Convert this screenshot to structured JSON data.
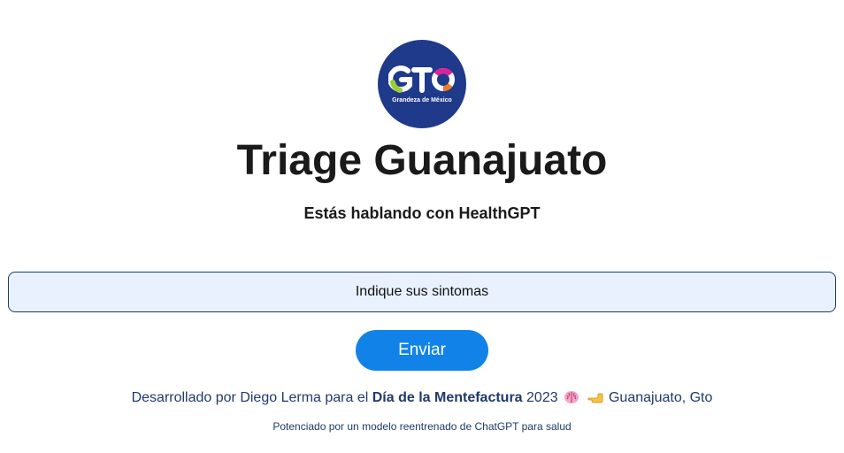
{
  "colors": {
    "logo_background": "#1f3a8a",
    "input_background": "#e8f1fd",
    "input_border": "#1f3a6b",
    "button_background": "#1183e8",
    "button_text": "#ffffff",
    "footer_text": "#1f3a6b"
  },
  "logo": {
    "text": "GTO",
    "tagline": "Grandeza de México",
    "icon": "gto-logo"
  },
  "header": {
    "title": "Triage Guanajuato",
    "subtitle": "Estás hablando con HealthGPT"
  },
  "chat": {
    "input_placeholder": "Indique sus sintomas",
    "input_value": "",
    "send_label": "Enviar"
  },
  "footer": {
    "credits_prefix": "Desarrollado por Diego Lerma para el",
    "credits_event": "Día de la Mentefactura",
    "credits_year": "2023",
    "emoji_1": "brain-emoji",
    "emoji_2": "pointing-hand-emoji",
    "credits_location": "Guanajuato, Gto",
    "powered_by": "Potenciado por un modelo reentrenado de ChatGPT para salud"
  }
}
